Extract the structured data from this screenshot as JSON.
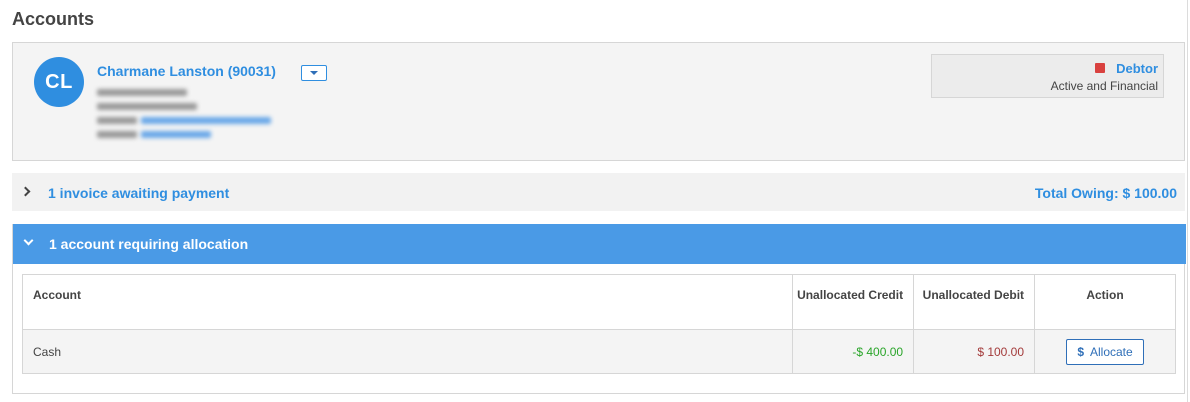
{
  "page": {
    "title": "Accounts"
  },
  "member": {
    "initials": "CL",
    "name": "Charmane Lanston (90031)"
  },
  "status": {
    "type": "Debtor",
    "description": "Active and Financial",
    "color": "#d9413f"
  },
  "invoices": {
    "label": "1 invoice awaiting payment",
    "total_owing": "Total Owing: $ 100.00"
  },
  "allocation": {
    "label": "1 account requiring allocation",
    "columns": {
      "account": "Account",
      "credit": "Unallocated Credit",
      "debit": "Unallocated Debit",
      "action": "Action"
    },
    "rows": [
      {
        "account": "Cash",
        "credit": "-$ 400.00",
        "debit": "$ 100.00",
        "action_label": "Allocate"
      }
    ]
  },
  "colors": {
    "accent": "#2f8ee0",
    "header_bar": "#4a9ae6",
    "credit": "#2aa52a",
    "debit": "#a33a3a"
  }
}
